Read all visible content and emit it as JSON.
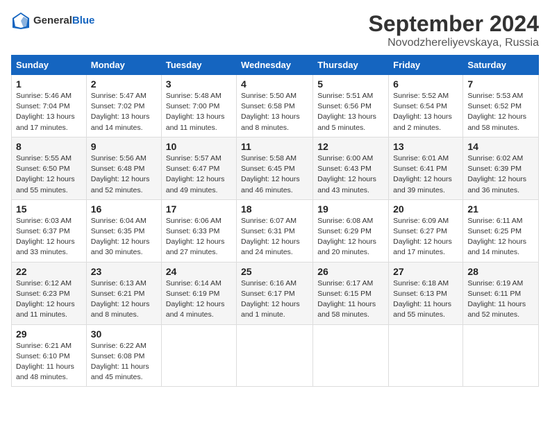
{
  "header": {
    "logo_general": "General",
    "logo_blue": "Blue",
    "month_title": "September 2024",
    "location": "Novodzhereliyevskaya, Russia"
  },
  "weekdays": [
    "Sunday",
    "Monday",
    "Tuesday",
    "Wednesday",
    "Thursday",
    "Friday",
    "Saturday"
  ],
  "weeks": [
    [
      {
        "day": "1",
        "sunrise": "Sunrise: 5:46 AM",
        "sunset": "Sunset: 7:04 PM",
        "daylight": "Daylight: 13 hours and 17 minutes."
      },
      {
        "day": "2",
        "sunrise": "Sunrise: 5:47 AM",
        "sunset": "Sunset: 7:02 PM",
        "daylight": "Daylight: 13 hours and 14 minutes."
      },
      {
        "day": "3",
        "sunrise": "Sunrise: 5:48 AM",
        "sunset": "Sunset: 7:00 PM",
        "daylight": "Daylight: 13 hours and 11 minutes."
      },
      {
        "day": "4",
        "sunrise": "Sunrise: 5:50 AM",
        "sunset": "Sunset: 6:58 PM",
        "daylight": "Daylight: 13 hours and 8 minutes."
      },
      {
        "day": "5",
        "sunrise": "Sunrise: 5:51 AM",
        "sunset": "Sunset: 6:56 PM",
        "daylight": "Daylight: 13 hours and 5 minutes."
      },
      {
        "day": "6",
        "sunrise": "Sunrise: 5:52 AM",
        "sunset": "Sunset: 6:54 PM",
        "daylight": "Daylight: 13 hours and 2 minutes."
      },
      {
        "day": "7",
        "sunrise": "Sunrise: 5:53 AM",
        "sunset": "Sunset: 6:52 PM",
        "daylight": "Daylight: 12 hours and 58 minutes."
      }
    ],
    [
      {
        "day": "8",
        "sunrise": "Sunrise: 5:55 AM",
        "sunset": "Sunset: 6:50 PM",
        "daylight": "Daylight: 12 hours and 55 minutes."
      },
      {
        "day": "9",
        "sunrise": "Sunrise: 5:56 AM",
        "sunset": "Sunset: 6:48 PM",
        "daylight": "Daylight: 12 hours and 52 minutes."
      },
      {
        "day": "10",
        "sunrise": "Sunrise: 5:57 AM",
        "sunset": "Sunset: 6:47 PM",
        "daylight": "Daylight: 12 hours and 49 minutes."
      },
      {
        "day": "11",
        "sunrise": "Sunrise: 5:58 AM",
        "sunset": "Sunset: 6:45 PM",
        "daylight": "Daylight: 12 hours and 46 minutes."
      },
      {
        "day": "12",
        "sunrise": "Sunrise: 6:00 AM",
        "sunset": "Sunset: 6:43 PM",
        "daylight": "Daylight: 12 hours and 43 minutes."
      },
      {
        "day": "13",
        "sunrise": "Sunrise: 6:01 AM",
        "sunset": "Sunset: 6:41 PM",
        "daylight": "Daylight: 12 hours and 39 minutes."
      },
      {
        "day": "14",
        "sunrise": "Sunrise: 6:02 AM",
        "sunset": "Sunset: 6:39 PM",
        "daylight": "Daylight: 12 hours and 36 minutes."
      }
    ],
    [
      {
        "day": "15",
        "sunrise": "Sunrise: 6:03 AM",
        "sunset": "Sunset: 6:37 PM",
        "daylight": "Daylight: 12 hours and 33 minutes."
      },
      {
        "day": "16",
        "sunrise": "Sunrise: 6:04 AM",
        "sunset": "Sunset: 6:35 PM",
        "daylight": "Daylight: 12 hours and 30 minutes."
      },
      {
        "day": "17",
        "sunrise": "Sunrise: 6:06 AM",
        "sunset": "Sunset: 6:33 PM",
        "daylight": "Daylight: 12 hours and 27 minutes."
      },
      {
        "day": "18",
        "sunrise": "Sunrise: 6:07 AM",
        "sunset": "Sunset: 6:31 PM",
        "daylight": "Daylight: 12 hours and 24 minutes."
      },
      {
        "day": "19",
        "sunrise": "Sunrise: 6:08 AM",
        "sunset": "Sunset: 6:29 PM",
        "daylight": "Daylight: 12 hours and 20 minutes."
      },
      {
        "day": "20",
        "sunrise": "Sunrise: 6:09 AM",
        "sunset": "Sunset: 6:27 PM",
        "daylight": "Daylight: 12 hours and 17 minutes."
      },
      {
        "day": "21",
        "sunrise": "Sunrise: 6:11 AM",
        "sunset": "Sunset: 6:25 PM",
        "daylight": "Daylight: 12 hours and 14 minutes."
      }
    ],
    [
      {
        "day": "22",
        "sunrise": "Sunrise: 6:12 AM",
        "sunset": "Sunset: 6:23 PM",
        "daylight": "Daylight: 12 hours and 11 minutes."
      },
      {
        "day": "23",
        "sunrise": "Sunrise: 6:13 AM",
        "sunset": "Sunset: 6:21 PM",
        "daylight": "Daylight: 12 hours and 8 minutes."
      },
      {
        "day": "24",
        "sunrise": "Sunrise: 6:14 AM",
        "sunset": "Sunset: 6:19 PM",
        "daylight": "Daylight: 12 hours and 4 minutes."
      },
      {
        "day": "25",
        "sunrise": "Sunrise: 6:16 AM",
        "sunset": "Sunset: 6:17 PM",
        "daylight": "Daylight: 12 hours and 1 minute."
      },
      {
        "day": "26",
        "sunrise": "Sunrise: 6:17 AM",
        "sunset": "Sunset: 6:15 PM",
        "daylight": "Daylight: 11 hours and 58 minutes."
      },
      {
        "day": "27",
        "sunrise": "Sunrise: 6:18 AM",
        "sunset": "Sunset: 6:13 PM",
        "daylight": "Daylight: 11 hours and 55 minutes."
      },
      {
        "day": "28",
        "sunrise": "Sunrise: 6:19 AM",
        "sunset": "Sunset: 6:11 PM",
        "daylight": "Daylight: 11 hours and 52 minutes."
      }
    ],
    [
      {
        "day": "29",
        "sunrise": "Sunrise: 6:21 AM",
        "sunset": "Sunset: 6:10 PM",
        "daylight": "Daylight: 11 hours and 48 minutes."
      },
      {
        "day": "30",
        "sunrise": "Sunrise: 6:22 AM",
        "sunset": "Sunset: 6:08 PM",
        "daylight": "Daylight: 11 hours and 45 minutes."
      },
      null,
      null,
      null,
      null,
      null
    ]
  ]
}
